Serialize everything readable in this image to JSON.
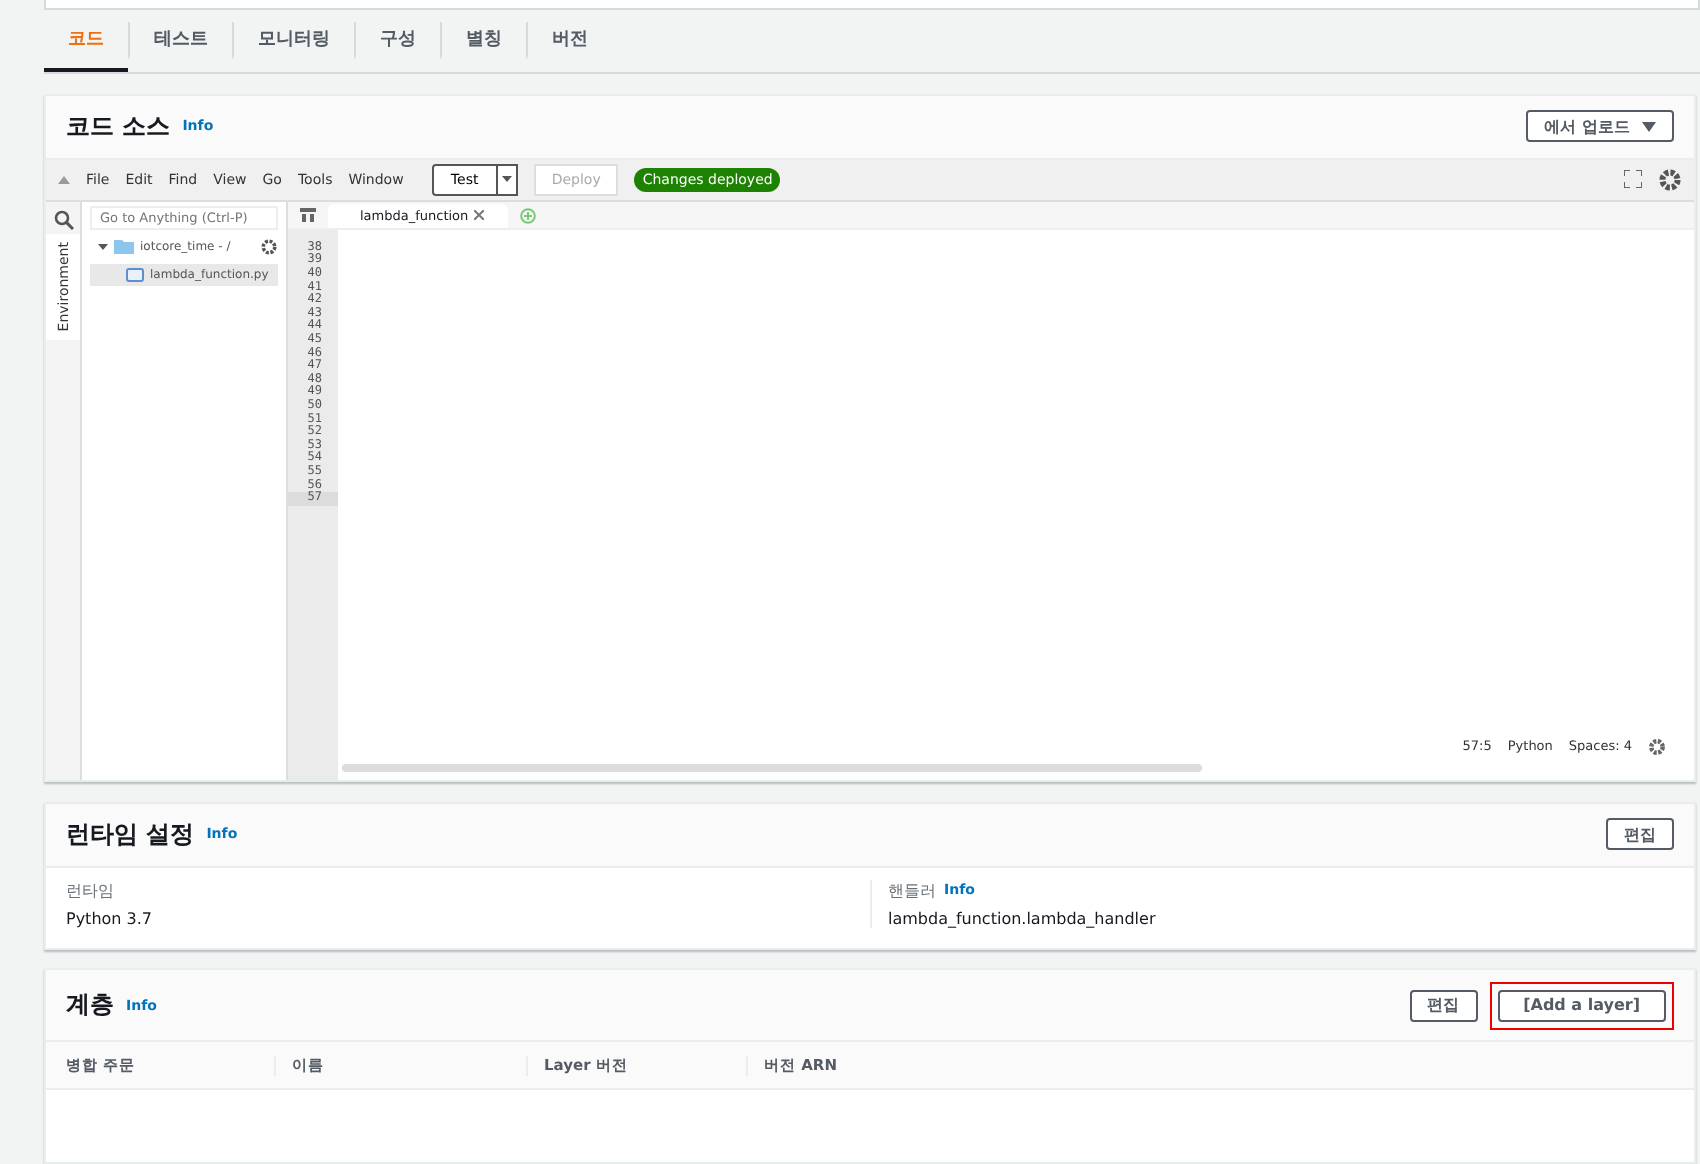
{
  "tabs": [
    {
      "label": "코드",
      "selected": true
    },
    {
      "label": "테스트",
      "selected": false
    },
    {
      "label": "모니터링",
      "selected": false
    },
    {
      "label": "구성",
      "selected": false
    },
    {
      "label": "별칭",
      "selected": false
    },
    {
      "label": "버전",
      "selected": false
    }
  ],
  "code_source": {
    "title": "코드 소스",
    "info": "Info",
    "upload_button": "에서 업로드",
    "menu": [
      "File",
      "Edit",
      "Find",
      "View",
      "Go",
      "Tools",
      "Window"
    ],
    "test_button": "Test",
    "deploy_button": {
      "label": "Deploy",
      "disabled": true
    },
    "status_badge": "Changes deployed",
    "search": {
      "placeholder": "Go to Anything (Ctrl-P)"
    },
    "side_tab": "Environment",
    "tree": [
      {
        "label": "iotcore_time - /",
        "expanded": true,
        "children": [
          {
            "label": "lambda_function.py",
            "selected": true
          }
        ]
      }
    ],
    "editor_tab": "lambda_function",
    "line_numbers": [
      "38",
      "39",
      "40",
      "41",
      "42",
      "43",
      "44",
      "45",
      "46",
      "47",
      "48",
      "49",
      "50",
      "51",
      "52",
      "53",
      "54",
      "55",
      "56",
      "57"
    ],
    "status": {
      "position": "57:5",
      "language": "Python",
      "spaces": "Spaces: 4"
    }
  },
  "runtime": {
    "title": "런타임 설정",
    "info": "Info",
    "edit_button": "편집",
    "fields": [
      {
        "label": "런타임",
        "value": "Python 3.7"
      },
      {
        "label": "핸들러",
        "info": "Info",
        "value": "lambda_function.lambda_handler"
      }
    ]
  },
  "layers": {
    "title": "계층",
    "info": "Info",
    "edit_button": "편집",
    "add_button": {
      "label": "[Add a layer]",
      "highlighted": true
    },
    "columns": [
      "병합 주문",
      "이름",
      "Layer 버전",
      "버전 ARN"
    ]
  }
}
